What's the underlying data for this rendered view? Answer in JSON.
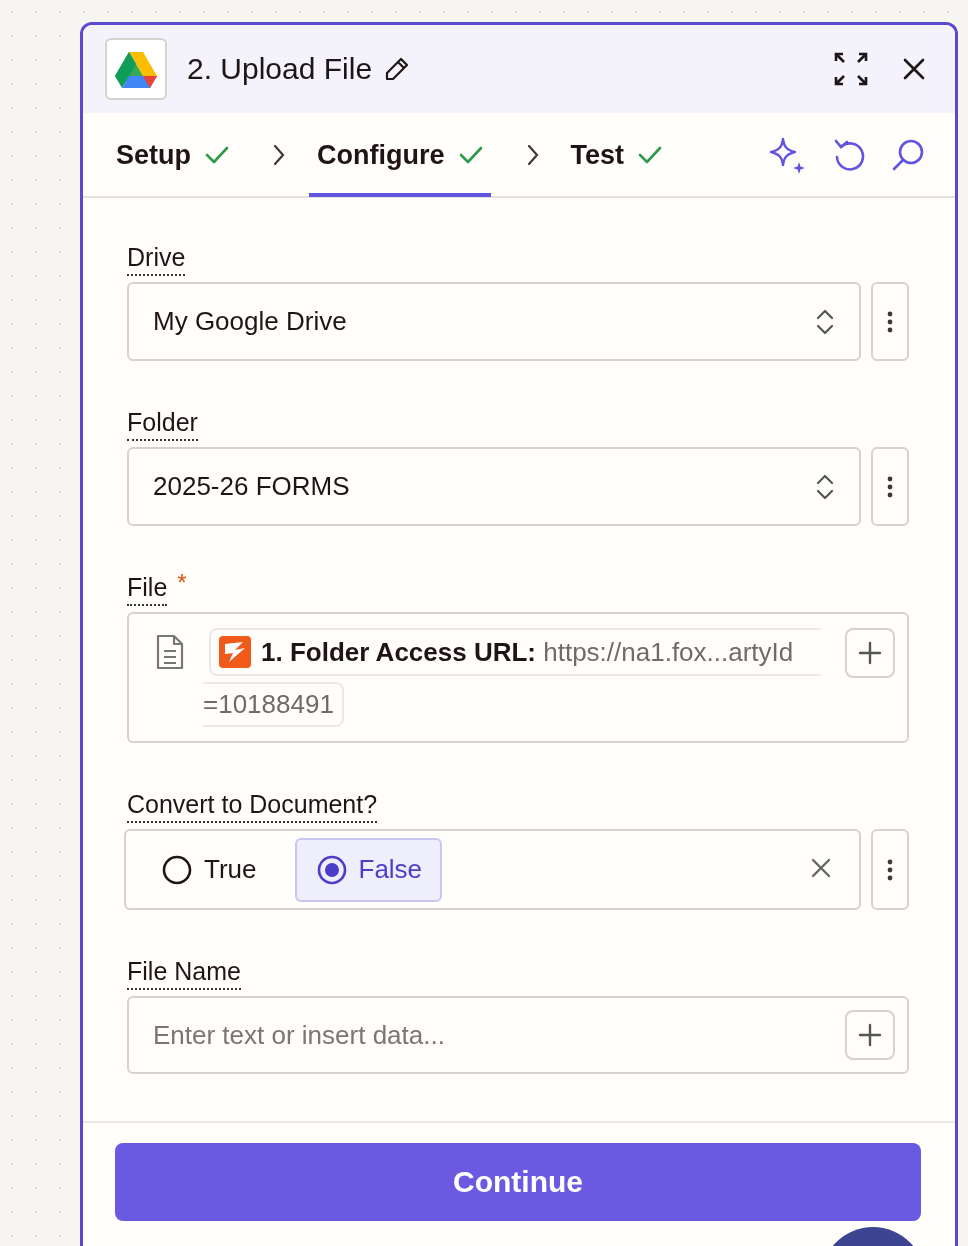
{
  "header": {
    "title": "2. Upload File"
  },
  "tabs": [
    {
      "label": "Setup",
      "selected": false,
      "done": true
    },
    {
      "label": "Configure",
      "selected": true,
      "done": true
    },
    {
      "label": "Test",
      "selected": false,
      "done": true
    }
  ],
  "fields": [
    {
      "kind": "select",
      "label": "Drive",
      "value": "My Google Drive"
    },
    {
      "kind": "select",
      "label": "Folder",
      "value": "2025-26 FORMS"
    },
    {
      "kind": "pill",
      "label": "File",
      "required_mark": "*",
      "pill_step": "1. Folder Access URL:",
      "pill_value": "https://na1.fox...artyId",
      "pill_overflow": "=10188491"
    },
    {
      "kind": "radio",
      "label": "Convert to Document?",
      "options": [
        {
          "label": "True",
          "selected": false
        },
        {
          "label": "False",
          "selected": true
        }
      ]
    },
    {
      "kind": "text",
      "label": "File Name",
      "placeholder": "Enter text or insert data..."
    }
  ],
  "button": "Continue"
}
